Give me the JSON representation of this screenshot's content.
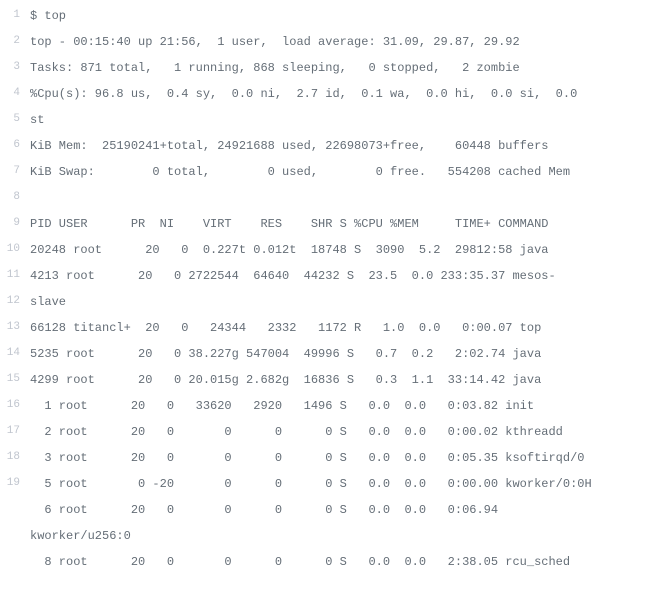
{
  "lines": [
    {
      "n": "1",
      "text": "$ top"
    },
    {
      "n": "2",
      "text": "top - 00:15:40 up 21:56,  1 user,  load average: 31.09, 29.87, 29.92"
    },
    {
      "n": "3",
      "text": "Tasks: 871 total,   1 running, 868 sleeping,   0 stopped,   2 zombie"
    },
    {
      "n": "4",
      "text": "%Cpu(s): 96.8 us,  0.4 sy,  0.0 ni,  2.7 id,  0.1 wa,  0.0 hi,  0.0 si,  0.0 "
    },
    {
      "n": "5",
      "text": "st"
    },
    {
      "n": "6",
      "text": "KiB Mem:  25190241+total, 24921688 used, 22698073+free,    60448 buffers"
    },
    {
      "n": "7",
      "text": "KiB Swap:        0 total,        0 used,        0 free.   554208 cached Mem"
    },
    {
      "n": "8",
      "text": ""
    },
    {
      "n": "9",
      "text": "PID USER      PR  NI    VIRT    RES    SHR S %CPU %MEM     TIME+ COMMAND"
    },
    {
      "n": "10",
      "text": "20248 root      20   0  0.227t 0.012t  18748 S  3090  5.2  29812:58 java"
    },
    {
      "n": "11",
      "text": "4213 root      20   0 2722544  64640  44232 S  23.5  0.0 233:35.37 mesos-"
    },
    {
      "n": "12",
      "text": "slave"
    },
    {
      "n": "13",
      "text": "66128 titancl+  20   0   24344   2332   1172 R   1.0  0.0   0:00.07 top"
    },
    {
      "n": "14",
      "text": "5235 root      20   0 38.227g 547004  49996 S   0.7  0.2   2:02.74 java"
    },
    {
      "n": "15",
      "text": "4299 root      20   0 20.015g 2.682g  16836 S   0.3  1.1  33:14.42 java"
    },
    {
      "n": "16",
      "text": "  1 root      20   0   33620   2920   1496 S   0.0  0.0   0:03.82 init"
    },
    {
      "n": "17",
      "text": "  2 root      20   0       0      0      0 S   0.0  0.0   0:00.02 kthreadd"
    },
    {
      "n": "18",
      "text": "  3 root      20   0       0      0      0 S   0.0  0.0   0:05.35 ksoftirqd/0"
    },
    {
      "n": "19",
      "text": "  5 root       0 -20       0      0      0 S   0.0  0.0   0:00.00 kworker/0:0H"
    },
    {
      "n": "",
      "text": "  6 root      20   0       0      0      0 S   0.0  0.0   0:06.94 "
    },
    {
      "n": "",
      "text": "kworker/u256:0"
    },
    {
      "n": "",
      "text": "  8 root      20   0       0      0      0 S   0.0  0.0   2:38.05 rcu_sched"
    }
  ]
}
